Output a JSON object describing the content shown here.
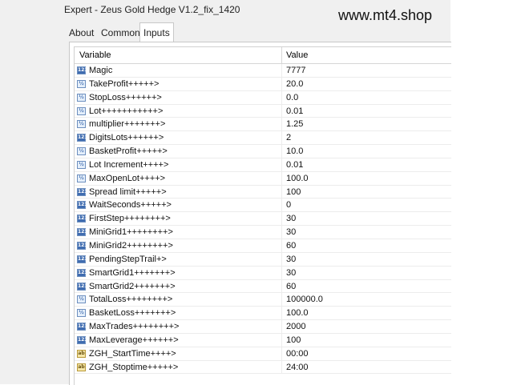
{
  "window": {
    "title": "Expert - Zeus Gold Hedge V1.2_fix_1420",
    "watermark": "www.mt4.shop"
  },
  "tabs": [
    {
      "label": "About",
      "active": false
    },
    {
      "label": "Common",
      "active": false
    },
    {
      "label": "Inputs",
      "active": true
    }
  ],
  "table": {
    "headers": {
      "variable": "Variable",
      "value": "Value"
    },
    "rows": [
      {
        "type": "int",
        "name": "Magic",
        "value": "7777"
      },
      {
        "type": "dbl",
        "name": "TakeProfit+++++>",
        "value": "20.0"
      },
      {
        "type": "dbl",
        "name": "StopLoss++++++>",
        "value": "0.0"
      },
      {
        "type": "dbl",
        "name": "Lot+++++++++++>",
        "value": "0.01"
      },
      {
        "type": "dbl",
        "name": "multiplier+++++++>",
        "value": "1.25"
      },
      {
        "type": "int",
        "name": "DigitsLots++++++>",
        "value": "2"
      },
      {
        "type": "dbl",
        "name": "BasketProfit+++++>",
        "value": "10.0"
      },
      {
        "type": "dbl",
        "name": "Lot Increment++++>",
        "value": "0.01"
      },
      {
        "type": "dbl",
        "name": "MaxOpenLot++++>",
        "value": "100.0"
      },
      {
        "type": "int",
        "name": "Spread limit+++++>",
        "value": "100"
      },
      {
        "type": "int",
        "name": "WaitSeconds+++++>",
        "value": "0"
      },
      {
        "type": "int",
        "name": "FirstStep++++++++>",
        "value": "30"
      },
      {
        "type": "int",
        "name": "MiniGrid1++++++++>",
        "value": "30"
      },
      {
        "type": "int",
        "name": "MiniGrid2++++++++>",
        "value": "60"
      },
      {
        "type": "int",
        "name": "PendingStepTrail+>",
        "value": "30"
      },
      {
        "type": "int",
        "name": "SmartGrid1+++++++>",
        "value": "30"
      },
      {
        "type": "int",
        "name": "SmartGrid2+++++++>",
        "value": "60"
      },
      {
        "type": "dbl",
        "name": "TotalLoss++++++++>",
        "value": "100000.0"
      },
      {
        "type": "dbl",
        "name": "BasketLoss+++++++>",
        "value": "100.0"
      },
      {
        "type": "int",
        "name": "MaxTrades++++++++>",
        "value": "2000"
      },
      {
        "type": "int",
        "name": "MaxLeverage++++++>",
        "value": "100"
      },
      {
        "type": "str",
        "name": "ZGH_StartTime++++>",
        "value": "00:00"
      },
      {
        "type": "str",
        "name": "ZGH_Stoptime+++++>",
        "value": "24:00"
      }
    ]
  },
  "icon_labels": {
    "int": "123",
    "dbl": "½",
    "str": "ab"
  }
}
